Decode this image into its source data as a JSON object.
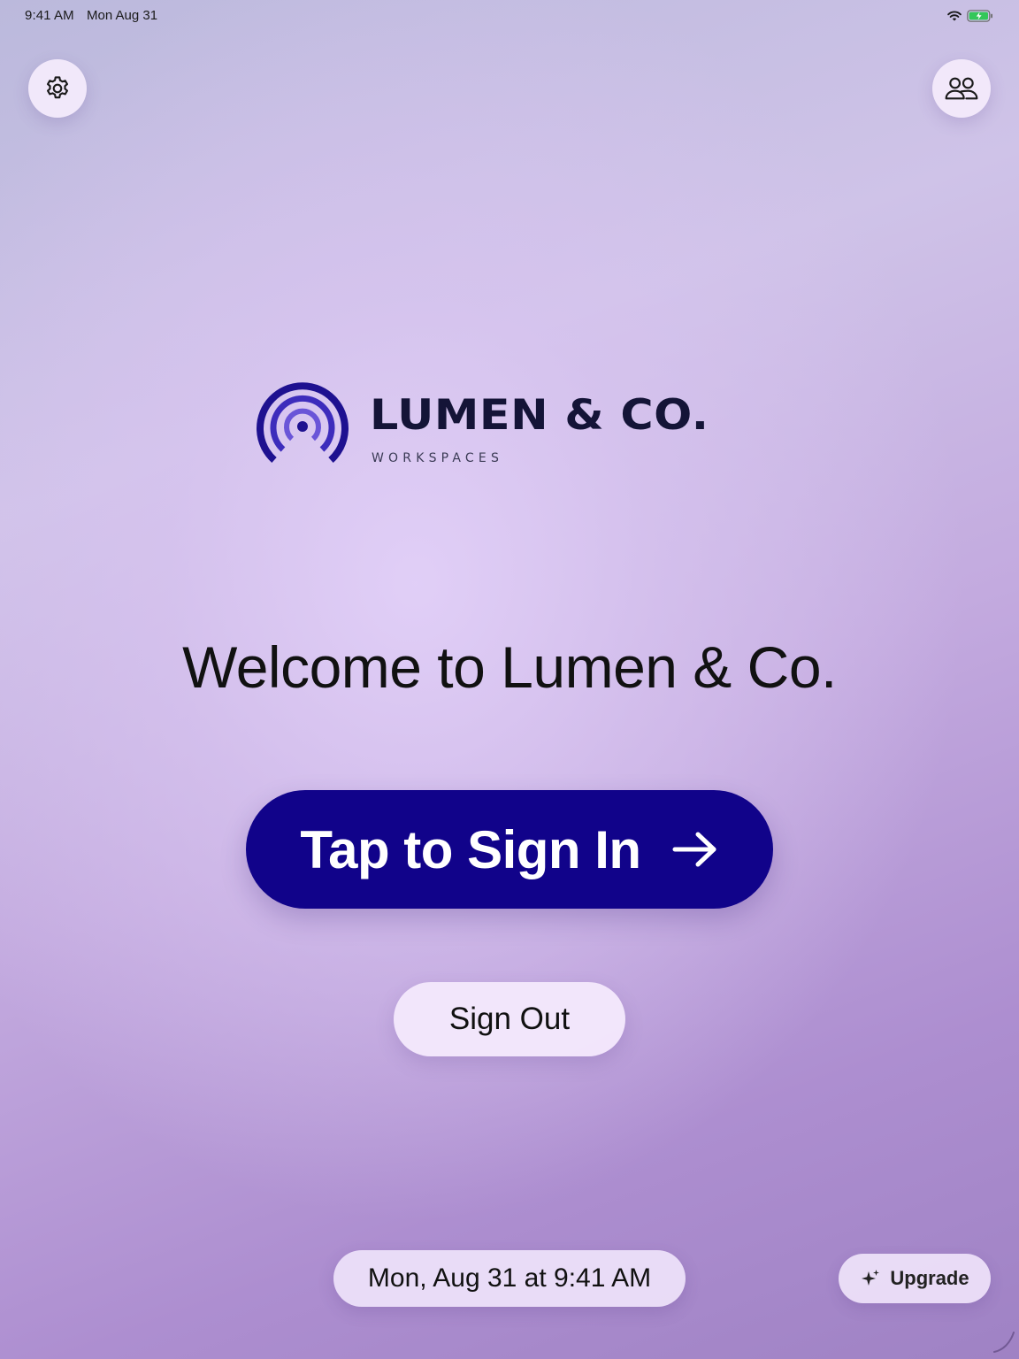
{
  "status_bar": {
    "time": "9:41 AM",
    "date": "Mon Aug 31",
    "wifi_icon": "wifi-icon",
    "battery_icon": "battery-charging-icon",
    "battery_color": "#34c759"
  },
  "toolbar": {
    "settings_icon": "gear-icon",
    "users_icon": "people-icon"
  },
  "logo": {
    "name": "LUMEN & CO.",
    "subtitle": "WORKSPACES",
    "mark_icon": "signal-arcs-icon",
    "mark_color": "#2a1ca0"
  },
  "main": {
    "welcome": "Welcome to Lumen & Co.",
    "sign_in_label": "Tap to Sign In",
    "sign_in_icon": "arrow-right-icon",
    "sign_in_color": "#11038a",
    "sign_out_label": "Sign Out"
  },
  "footer": {
    "datetime": "Mon, Aug 31 at 9:41 AM",
    "upgrade_label": "Upgrade",
    "upgrade_icon": "sparkle-icon"
  }
}
